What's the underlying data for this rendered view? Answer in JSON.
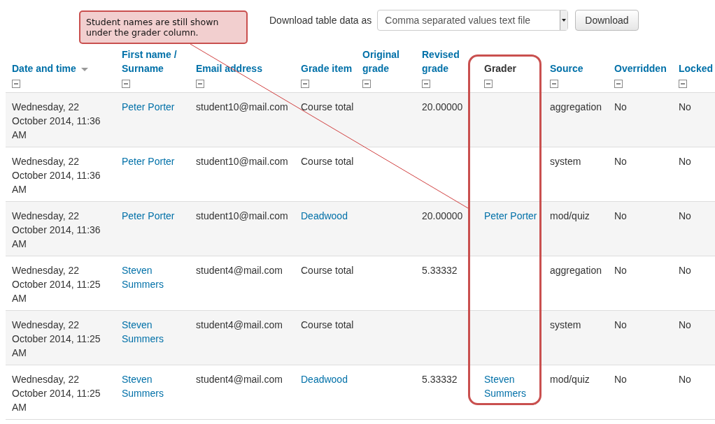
{
  "callout": {
    "text": "Student names are still shown under the grader column."
  },
  "download": {
    "label": "Download table data as",
    "format": "Comma separated values text file",
    "button": "Download"
  },
  "table": {
    "columns": [
      {
        "label": "Date and time",
        "sortable": true,
        "sorted": true
      },
      {
        "label": "First name / Surname",
        "sortable": true,
        "sorted": false
      },
      {
        "label": "Email address",
        "sortable": true,
        "sorted": false
      },
      {
        "label": "Grade item",
        "sortable": true,
        "sorted": false
      },
      {
        "label": "Original grade",
        "sortable": true,
        "sorted": false
      },
      {
        "label": "Revised grade",
        "sortable": true,
        "sorted": false
      },
      {
        "label": "Grader",
        "sortable": false,
        "sorted": false
      },
      {
        "label": "Source",
        "sortable": true,
        "sorted": false
      },
      {
        "label": "Overridden",
        "sortable": true,
        "sorted": false
      },
      {
        "label": "Locked",
        "sortable": true,
        "sorted": false
      }
    ],
    "rows": [
      [
        {
          "text": "Wednesday, 22 October 2014, 11:36 AM",
          "link": false
        },
        {
          "text": "Peter Porter",
          "link": true
        },
        {
          "text": "student10@mail.com",
          "link": false
        },
        {
          "text": "Course total",
          "link": false
        },
        null,
        {
          "text": "20.00000",
          "link": false
        },
        null,
        {
          "text": "aggregation",
          "link": false
        },
        {
          "text": "No",
          "link": false
        },
        {
          "text": "No",
          "link": false
        }
      ],
      [
        {
          "text": "Wednesday, 22 October 2014, 11:36 AM",
          "link": false
        },
        {
          "text": "Peter Porter",
          "link": true
        },
        {
          "text": "student10@mail.com",
          "link": false
        },
        {
          "text": "Course total",
          "link": false
        },
        null,
        null,
        null,
        {
          "text": "system",
          "link": false
        },
        {
          "text": "No",
          "link": false
        },
        {
          "text": "No",
          "link": false
        }
      ],
      [
        {
          "text": "Wednesday, 22 October 2014, 11:36 AM",
          "link": false
        },
        {
          "text": "Peter Porter",
          "link": true
        },
        {
          "text": "student10@mail.com",
          "link": false
        },
        {
          "text": "Deadwood",
          "link": true
        },
        null,
        {
          "text": "20.00000",
          "link": false
        },
        {
          "text": "Peter Porter",
          "link": true
        },
        {
          "text": "mod/quiz",
          "link": false
        },
        {
          "text": "No",
          "link": false
        },
        {
          "text": "No",
          "link": false
        }
      ],
      [
        {
          "text": "Wednesday, 22 October 2014, 11:25 AM",
          "link": false
        },
        {
          "text": "Steven Summers",
          "link": true
        },
        {
          "text": "student4@mail.com",
          "link": false
        },
        {
          "text": "Course total",
          "link": false
        },
        null,
        {
          "text": "5.33332",
          "link": false
        },
        null,
        {
          "text": "aggregation",
          "link": false
        },
        {
          "text": "No",
          "link": false
        },
        {
          "text": "No",
          "link": false
        }
      ],
      [
        {
          "text": "Wednesday, 22 October 2014, 11:25 AM",
          "link": false
        },
        {
          "text": "Steven Summers",
          "link": true
        },
        {
          "text": "student4@mail.com",
          "link": false
        },
        {
          "text": "Course total",
          "link": false
        },
        null,
        null,
        null,
        {
          "text": "system",
          "link": false
        },
        {
          "text": "No",
          "link": false
        },
        {
          "text": "No",
          "link": false
        }
      ],
      [
        {
          "text": "Wednesday, 22 October 2014, 11:25 AM",
          "link": false
        },
        {
          "text": "Steven Summers",
          "link": true
        },
        {
          "text": "student4@mail.com",
          "link": false
        },
        {
          "text": "Deadwood",
          "link": true
        },
        null,
        {
          "text": "5.33332",
          "link": false
        },
        {
          "text": "Steven Summers",
          "link": true
        },
        {
          "text": "mod/quiz",
          "link": false
        },
        {
          "text": "No",
          "link": false
        },
        {
          "text": "No",
          "link": false
        }
      ]
    ]
  }
}
